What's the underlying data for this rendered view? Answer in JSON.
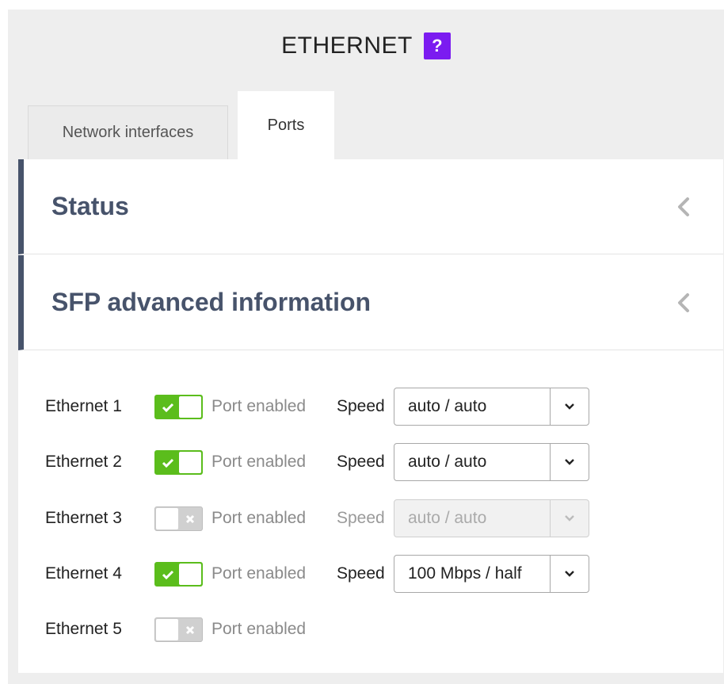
{
  "header": {
    "title": "ETHERNET",
    "help_label": "?"
  },
  "tabs": [
    {
      "label": "Network interfaces",
      "active": false
    },
    {
      "label": "Ports",
      "active": true
    }
  ],
  "sections": [
    {
      "title": "Status",
      "collapsed": true,
      "icon": "chevron-left-icon"
    },
    {
      "title": "SFP advanced information",
      "collapsed": true,
      "icon": "chevron-left-icon"
    }
  ],
  "ports": [
    {
      "name": "Ethernet 1",
      "enabled": true,
      "toggle_label": "Port enabled",
      "speed_label": "Speed",
      "speed": "auto / auto",
      "speed_disabled": false
    },
    {
      "name": "Ethernet 2",
      "enabled": true,
      "toggle_label": "Port enabled",
      "speed_label": "Speed",
      "speed": "auto / auto",
      "speed_disabled": false
    },
    {
      "name": "Ethernet 3",
      "enabled": false,
      "toggle_label": "Port enabled",
      "speed_label": "Speed",
      "speed": "auto / auto",
      "speed_disabled": true
    },
    {
      "name": "Ethernet 4",
      "enabled": true,
      "toggle_label": "Port enabled",
      "speed_label": "Speed",
      "speed": "100 Mbps / half",
      "speed_disabled": false
    },
    {
      "name": "Ethernet 5",
      "enabled": false,
      "toggle_label": "Port enabled"
    }
  ],
  "colors": {
    "accent": "#47536b",
    "help_badge": "#7b1bf0",
    "toggle_on": "#5bbd1c",
    "toggle_off": "#d0d0d0"
  }
}
